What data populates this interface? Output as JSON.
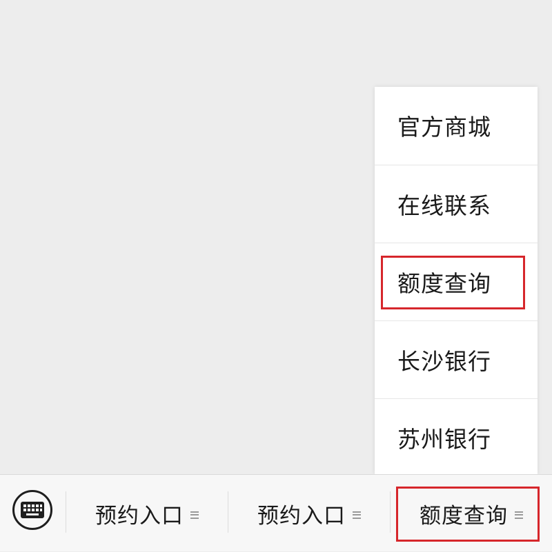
{
  "submenu": {
    "items": [
      {
        "label": "官方商城"
      },
      {
        "label": "在线联系"
      },
      {
        "label": "额度查询"
      },
      {
        "label": "长沙银行"
      },
      {
        "label": "苏州银行"
      }
    ]
  },
  "bottom_bar": {
    "keyboard_icon": "keyboard-icon",
    "menus": [
      {
        "label": "预约入口",
        "icon": "menu-lines-icon"
      },
      {
        "label": "预约入口",
        "icon": "menu-lines-icon"
      },
      {
        "label": "额度查询",
        "icon": "menu-lines-icon"
      }
    ]
  },
  "colors": {
    "background": "#ededed",
    "highlight": "#d6262b",
    "menu_bg": "#ffffff",
    "bar_bg": "#f7f7f7"
  }
}
